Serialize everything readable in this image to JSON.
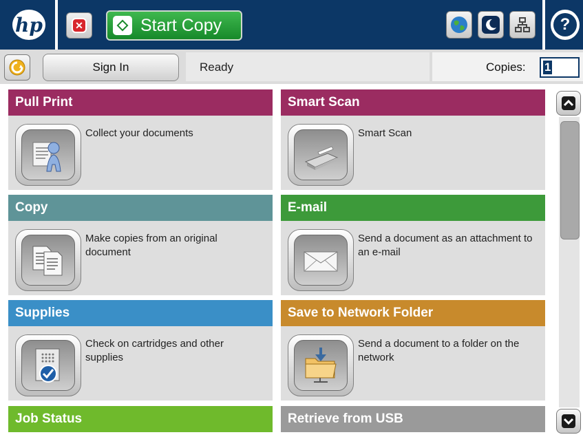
{
  "header": {
    "logo_text": "hp",
    "stop_icon": "stop-icon",
    "start_copy_label": "Start Copy",
    "icons": [
      "globe-icon",
      "sleep-moon-icon",
      "network-icon",
      "help-icon"
    ],
    "help_text": "?"
  },
  "status": {
    "sign_in_label": "Sign In",
    "status_text": "Ready",
    "copies_label": "Copies:",
    "copies_value": "1"
  },
  "tiles": [
    {
      "title": "Pull Print",
      "description": "Collect your documents",
      "color": "#9b2c61",
      "icon": "person-document-icon"
    },
    {
      "title": "Smart Scan",
      "description": "Smart Scan",
      "color": "#9b2c61",
      "icon": "scanner-icon"
    },
    {
      "title": "Copy",
      "description": "Make copies from an original document",
      "color": "#5f9498",
      "icon": "copy-documents-icon"
    },
    {
      "title": "E-mail",
      "description": "Send a document as an attachment to an e-mail",
      "color": "#3d9a3a",
      "icon": "envelope-icon"
    },
    {
      "title": "Supplies",
      "description": "Check on cartridges and other supplies",
      "color": "#3a8fc7",
      "icon": "supplies-check-icon"
    },
    {
      "title": "Save to Network Folder",
      "description": "Send a document to a folder on the network",
      "color": "#c88a2c",
      "icon": "network-folder-icon"
    },
    {
      "title": "Job Status",
      "color": "#6fba2c"
    },
    {
      "title": "Retrieve from USB",
      "color": "#9a9a9a"
    }
  ],
  "scrollbar": {
    "up_icon": "chevron-up-icon",
    "down_icon": "chevron-down-icon"
  }
}
